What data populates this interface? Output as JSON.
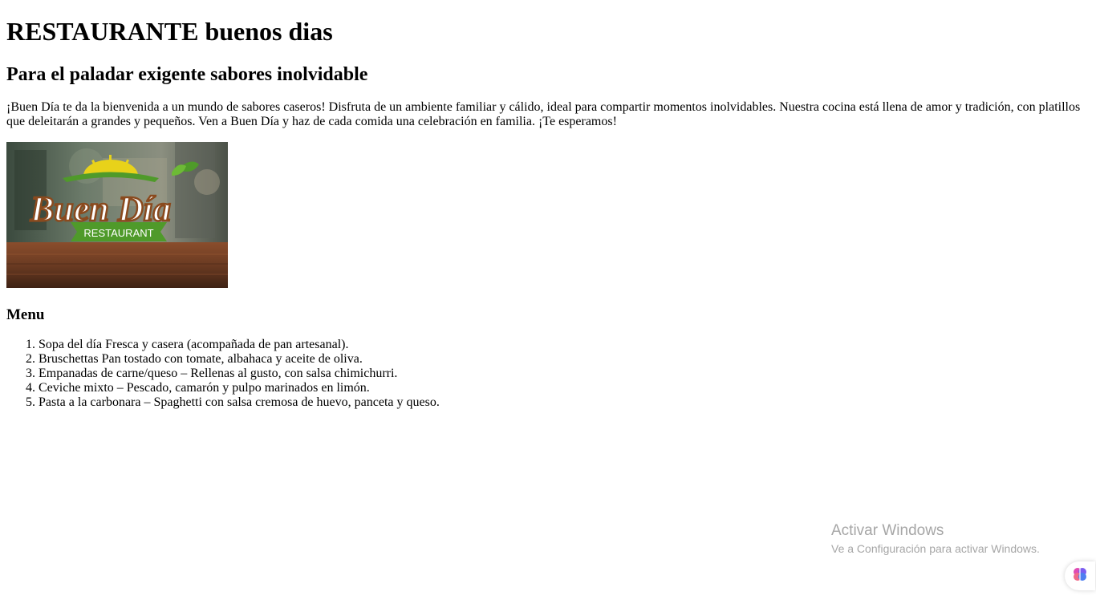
{
  "page": {
    "title": "RESTAURANTE buenos dias",
    "subtitle": "Para el paladar exigente sabores inolvidable",
    "intro": "¡Buen Día te da la bienvenida a un mundo de sabores caseros! Disfruta de un ambiente familiar y cálido, ideal para compartir momentos inolvidables. Nuestra cocina está llena de amor y tradición, con platillos que deleitarán a grandes y pequeños. Ven a Buen Día y haz de cada comida una celebración en familia. ¡Te esperamos!"
  },
  "logo": {
    "script_text": "Buen Día",
    "banner_text": "RESTAURANT"
  },
  "menu": {
    "heading": "Menu",
    "items": [
      "Sopa del día Fresca y casera (acompañada de pan artesanal).",
      "Bruschettas Pan tostado con tomate, albahaca y aceite de oliva.",
      "Empanadas de carne/queso – Rellenas al gusto, con salsa chimichurri.",
      "Ceviche mixto – Pescado, camarón y pulpo marinados en limón.",
      "Pasta a la carbonara – Spaghetti con salsa cremosa de huevo, panceta y queso."
    ]
  },
  "os_watermark": {
    "title": "Activar Windows",
    "subtitle": "Ve a Configuración para activar Windows."
  },
  "extension": {
    "icon": "brain-icon"
  },
  "colors": {
    "banner_green": "#4f9a2a",
    "logo_brown": "#8a4a1e",
    "sun_yellow": "#e8d21a",
    "table_wood": "#6b3b22",
    "watermark_gray": "#a6a6a6"
  }
}
